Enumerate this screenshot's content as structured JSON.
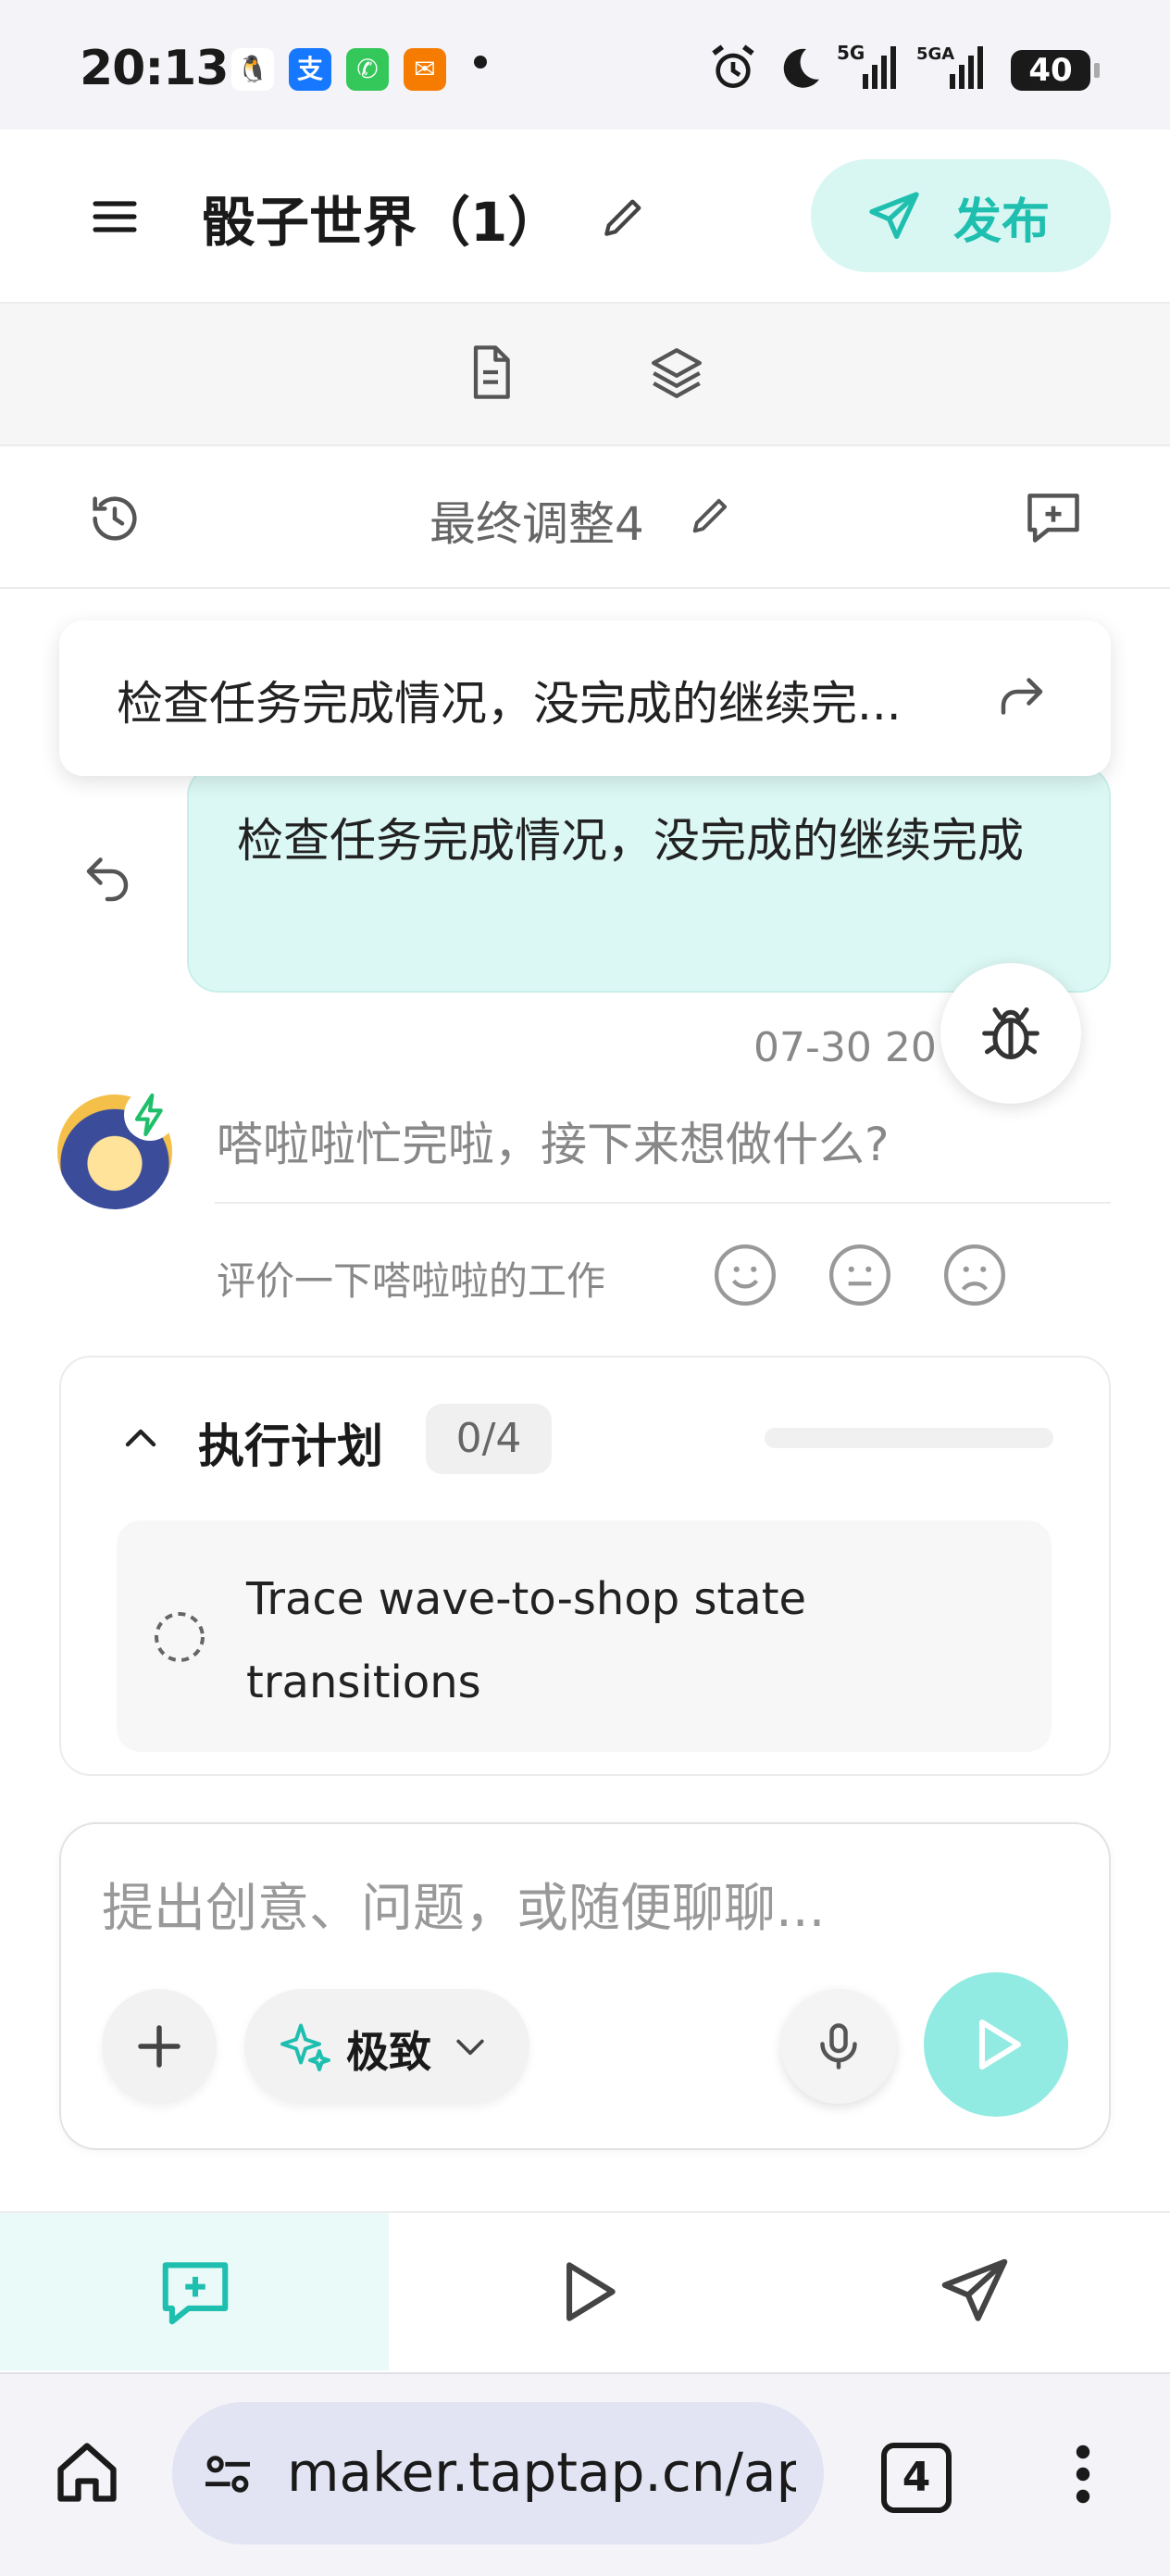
{
  "status_bar": {
    "time": "20:13",
    "battery": "40",
    "network1": "5G",
    "network2": "5GA"
  },
  "header": {
    "title": "骰子世界（1）",
    "publish_label": "发布",
    "accent_color": "#1fbfb0"
  },
  "toolbar": {
    "icons": [
      "document-icon",
      "layers-icon"
    ]
  },
  "version_row": {
    "label": "最终调整4"
  },
  "chat": {
    "pending_message": "检查任务完成情况，没完成的继续完...",
    "user_message": "检查任务完成情况，没完成的继续完成",
    "timestamp": "07-30 20",
    "ai_message": "嗒啦啦忙完啦，接下来想做什么?",
    "rating_prompt": "评价一下嗒啦啦的工作"
  },
  "plan": {
    "title": "执行计划",
    "count": "0/4",
    "progress": 0,
    "task": "Trace wave-to-shop state transitions"
  },
  "composer": {
    "placeholder": "提出创意、问题，或随便聊聊...",
    "mode_label": "极致"
  },
  "bottom_tabs": [
    "chat",
    "play",
    "publish"
  ],
  "browser": {
    "url": "maker.taptap.cn/app",
    "tab_count": "4"
  }
}
